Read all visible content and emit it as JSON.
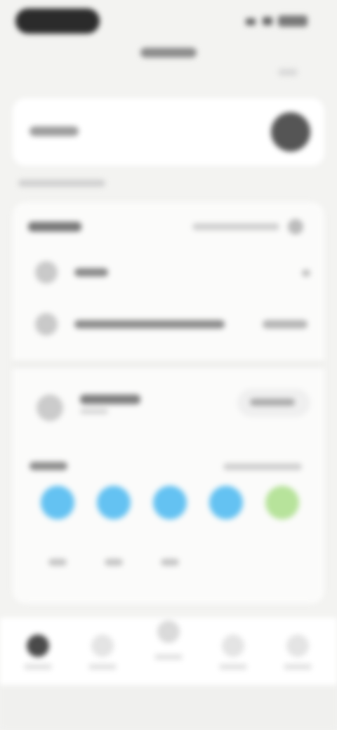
{
  "note": "",
  "colors": {
    "background": "#f3f3f1",
    "card": "#ffffff",
    "accent_blue": "#64c2f2",
    "accent_green": "#b7e39b",
    "dark": "#2b2b2b"
  },
  "icons": {
    "status": [
      "signal-icon",
      "wifi-icon",
      "battery-icon"
    ],
    "rows": [
      "item-icon",
      "item-icon",
      "item-icon"
    ],
    "nav": [
      "home-icon",
      "nav-icon",
      "center-icon",
      "nav-icon",
      "nav-icon"
    ]
  }
}
